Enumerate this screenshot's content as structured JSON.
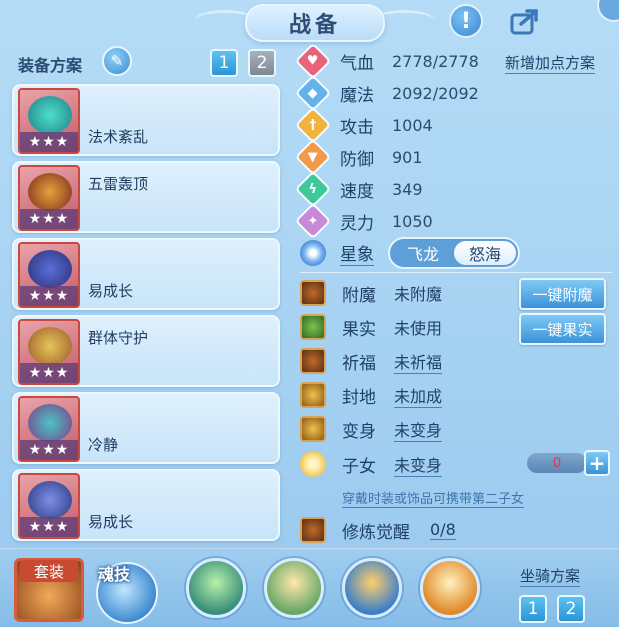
{
  "header": {
    "title": "战备",
    "help_icon": "!",
    "share_icon": "share-icon"
  },
  "equip": {
    "section_label": "装备方案",
    "plans": [
      "1",
      "2"
    ],
    "active_plan": "1",
    "star_text": "★★★",
    "items": [
      {
        "skill": "法术紊乱",
        "icon": "sword-icon"
      },
      {
        "skill": "五雷轰顶",
        "icon": "claw-icon"
      },
      {
        "skill": "易成长",
        "icon": "armor-icon"
      },
      {
        "skill": "群体守护",
        "icon": "necklace-icon"
      },
      {
        "skill": "冷静",
        "icon": "belt-icon"
      },
      {
        "skill": "易成长",
        "icon": "boots-icon"
      }
    ]
  },
  "attributes": {
    "add_plan_label": "新增加点方案",
    "rows": [
      {
        "name": "气血",
        "value": "2778/2778",
        "color": "#e8637a",
        "glyph": "♥"
      },
      {
        "name": "魔法",
        "value": "2092/2092",
        "color": "#63b3ea",
        "glyph": "◆"
      },
      {
        "name": "攻击",
        "value": "1004",
        "color": "#f0b43c",
        "glyph": "†"
      },
      {
        "name": "防御",
        "value": "901",
        "color": "#f29a4a",
        "glyph": "▼"
      },
      {
        "name": "速度",
        "value": "349",
        "color": "#3fc89a",
        "glyph": "ϟ"
      },
      {
        "name": "灵力",
        "value": "1050",
        "color": "#c88ad8",
        "glyph": "✦"
      }
    ],
    "constellation": {
      "label": "星象",
      "options": [
        "飞龙",
        "怒海"
      ],
      "selected": "怒海"
    }
  },
  "enhance": {
    "rows": [
      {
        "name": "附魔",
        "value": "未附魔",
        "icon": "enchant-icon"
      },
      {
        "name": "果实",
        "value": "未使用",
        "icon": "fruit-icon"
      },
      {
        "name": "祈福",
        "value": "未祈福",
        "icon": "blessing-icon"
      },
      {
        "name": "封地",
        "value": "未加成",
        "icon": "fief-icon"
      },
      {
        "name": "变身",
        "value": "未变身",
        "icon": "transform-icon"
      },
      {
        "name": "子女",
        "value": "未变身",
        "icon": "child-icon"
      }
    ],
    "one_click_enchant": "一键附魔",
    "one_click_fruit": "一键果实",
    "child_count": "0",
    "plus": "+",
    "hint": "穿戴时装或饰品可携带第二子女",
    "cultivation": {
      "name": "修炼觉醒",
      "value": "0/8"
    }
  },
  "bottom": {
    "suit_label": "套装",
    "soul_label": "魂技",
    "mount_label": "坐骑方案",
    "mount_plans": [
      "1",
      "2"
    ]
  }
}
